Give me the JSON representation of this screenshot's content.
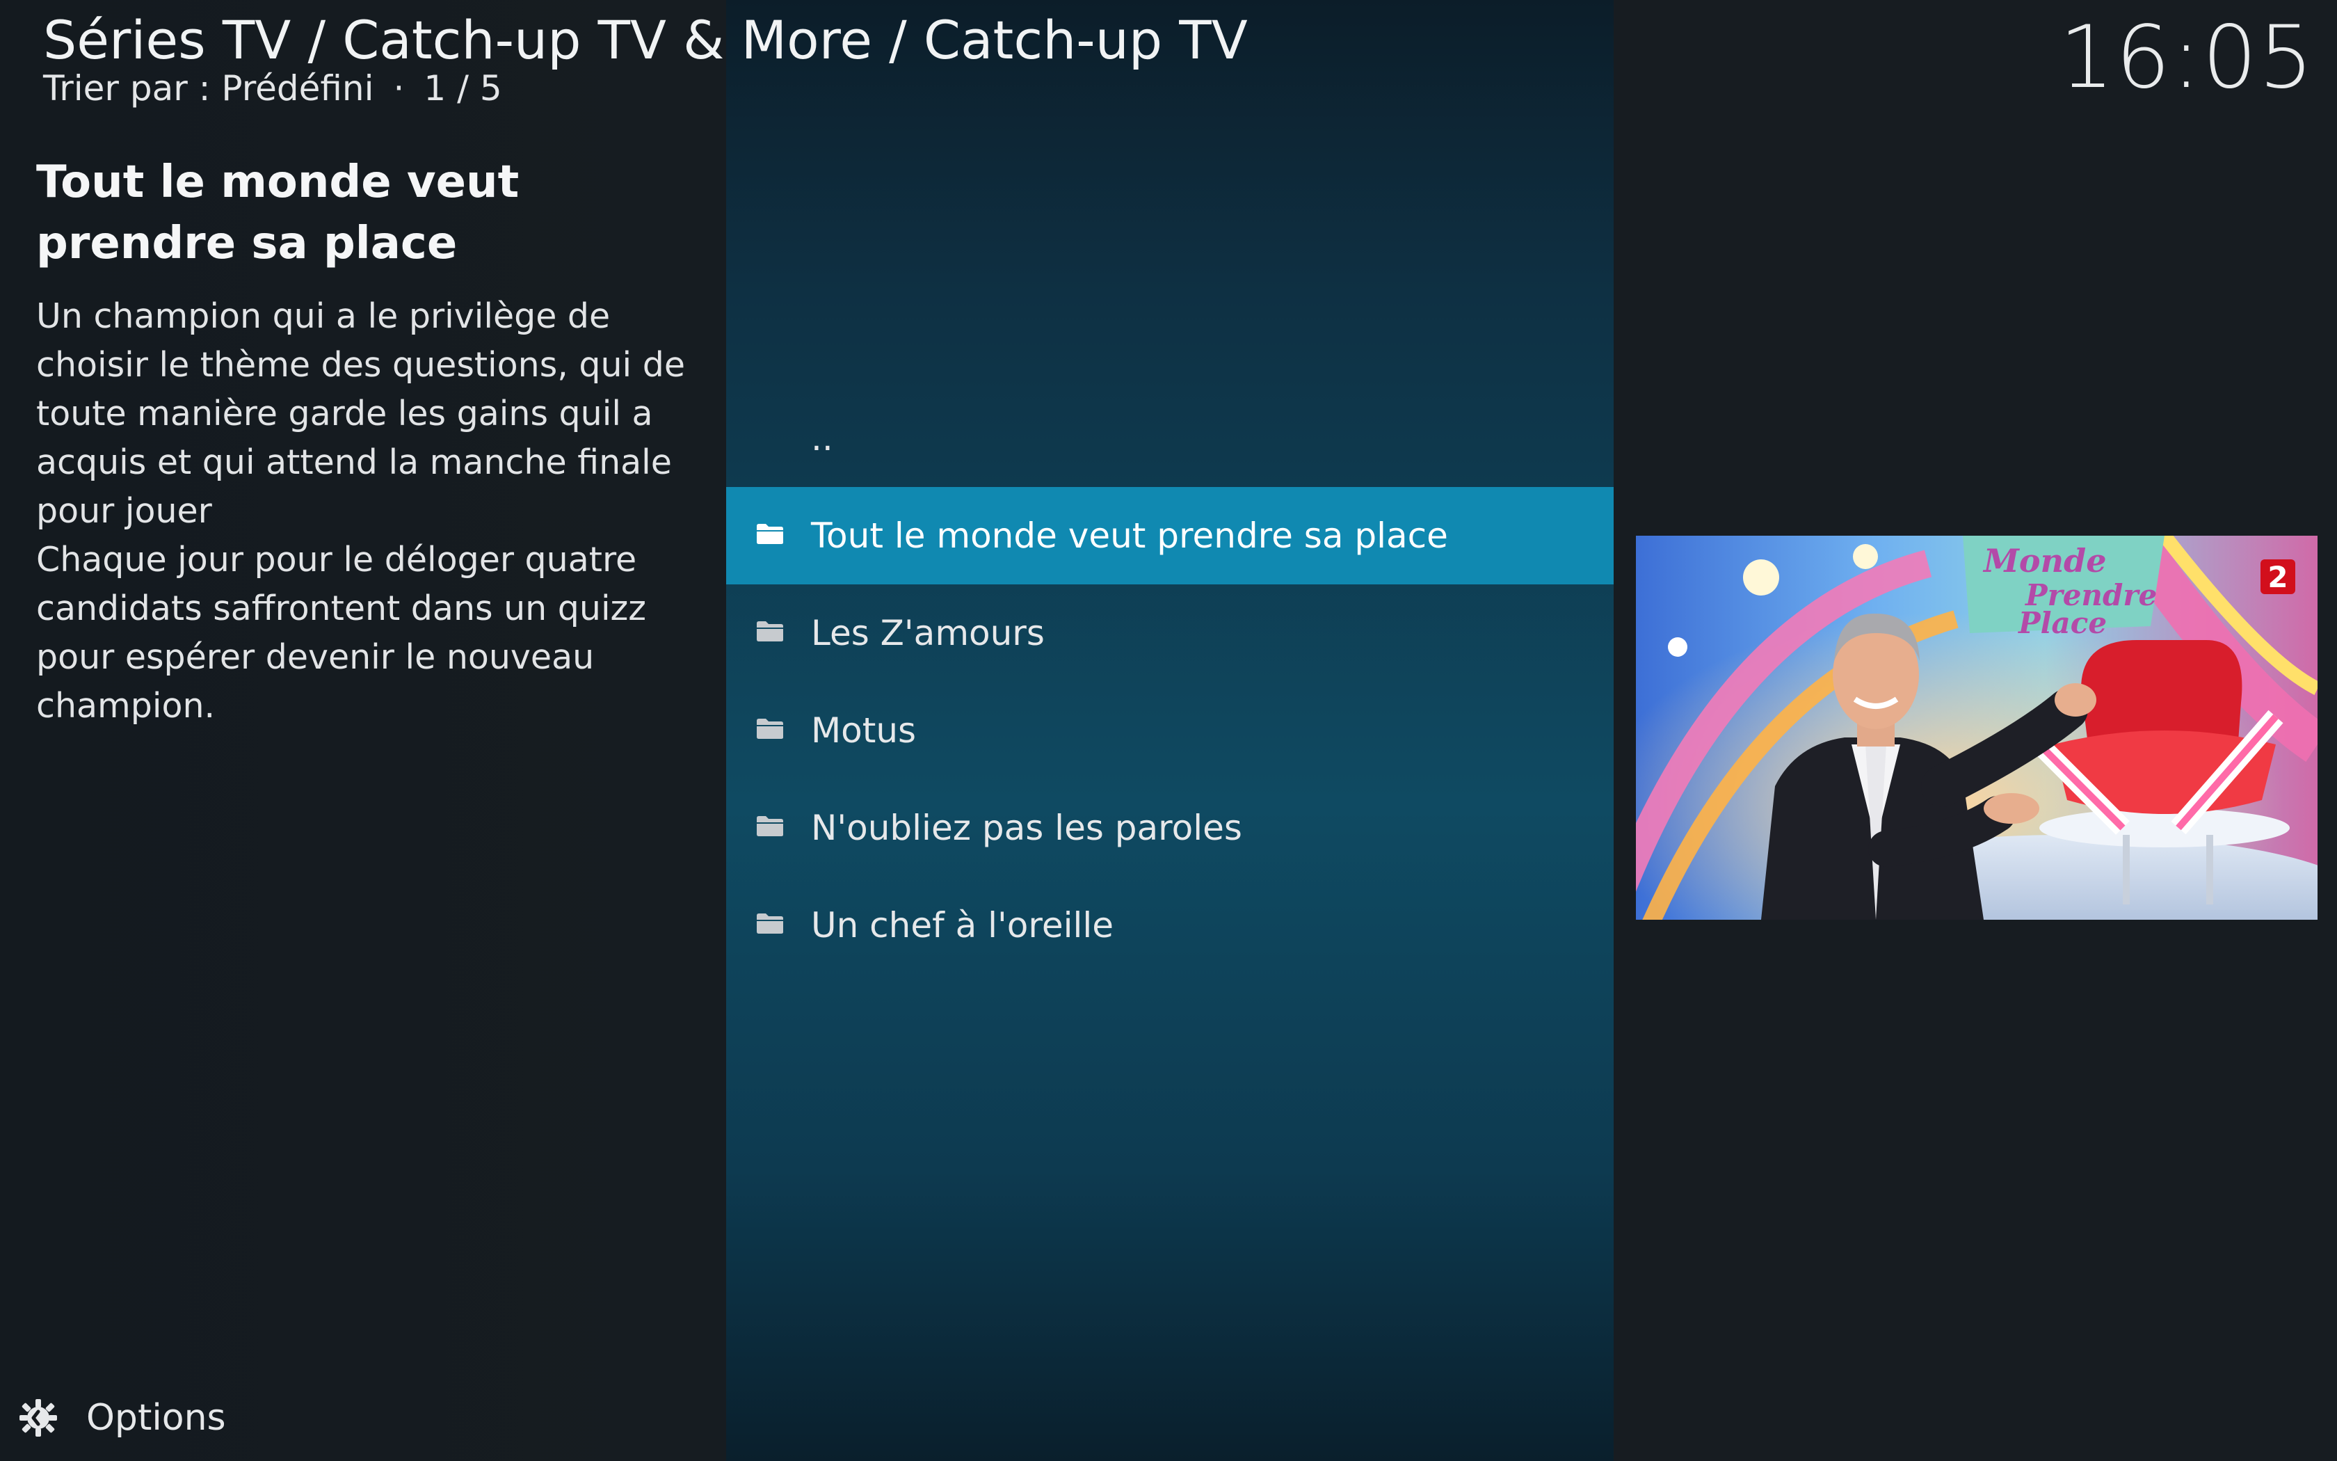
{
  "header": {
    "breadcrumb": "Séries TV / Catch-up TV & More / Catch-up TV",
    "sort_label": "Trier par : Prédéfini",
    "separator": "·",
    "position": "1 / 5",
    "clock": "16:05"
  },
  "info": {
    "title": "Tout le monde veut prendre sa place",
    "plot": "Un champion qui a le privilège de choisir le thème des questions, qui de toute manière garde les gains quil a acquis et qui attend la manche finale pour jouer\nChaque jour pour le déloger quatre candidats saffrontent dans un quizz pour espérer devenir le nouveau champion."
  },
  "list": {
    "parent": "..",
    "items": [
      {
        "label": "Tout le monde veut prendre sa place",
        "selected": true
      },
      {
        "label": "Les Z'amours",
        "selected": false
      },
      {
        "label": "Motus",
        "selected": false
      },
      {
        "label": "N'oubliez pas les paroles",
        "selected": false
      },
      {
        "label": "Un chef à l'oreille",
        "selected": false
      }
    ]
  },
  "thumbnail": {
    "logo_text": "2",
    "sign_line1": "Monde",
    "sign_line2": "Prendre",
    "sign_line3": "Place"
  },
  "footer": {
    "options_label": "Options"
  },
  "colors": {
    "selection": "#1089b1",
    "panel": "#0f4a62",
    "background": "#15191d"
  }
}
